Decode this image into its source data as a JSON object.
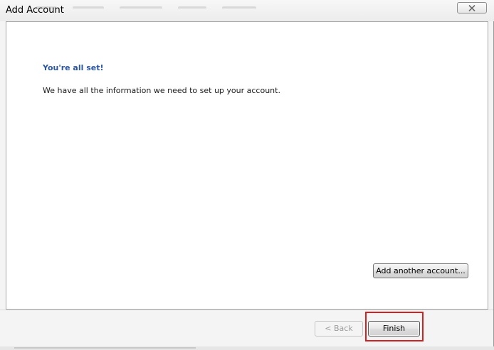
{
  "window": {
    "title": "Add Account"
  },
  "content": {
    "heading": "You're all set!",
    "message": "We have all the information we need to set up your account."
  },
  "buttons": {
    "add_another": "Add another account...",
    "back": "< Back",
    "finish": "Finish"
  },
  "colors": {
    "heading": "#2a56a4",
    "highlight": "#d42020"
  },
  "icons": {
    "close": "close-icon"
  }
}
